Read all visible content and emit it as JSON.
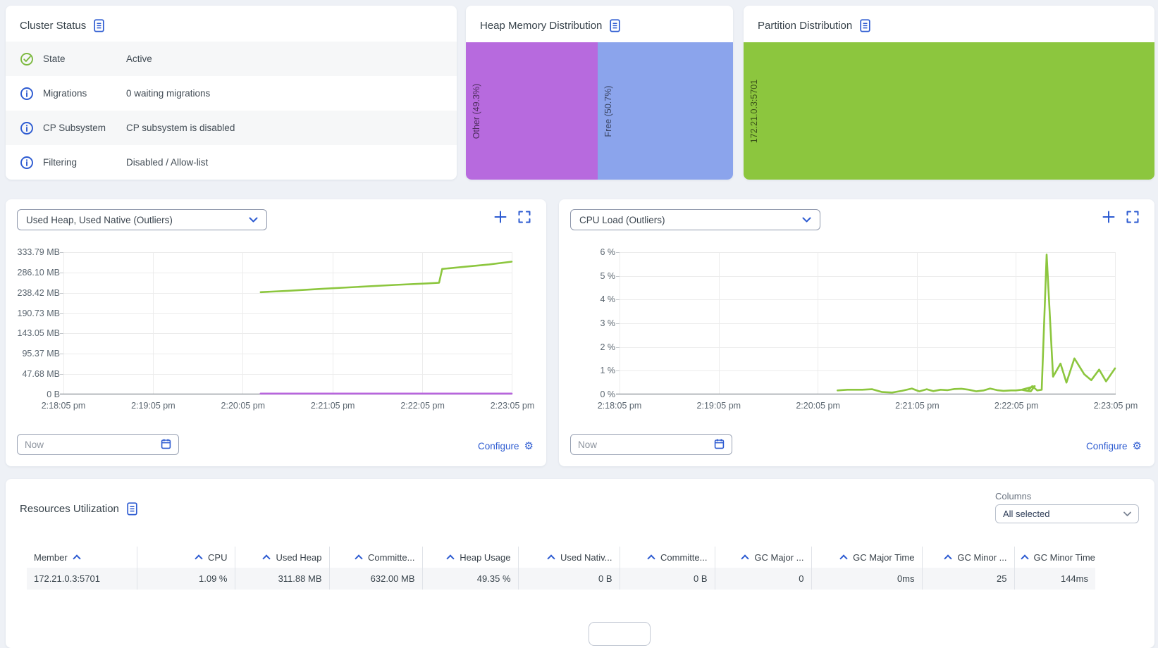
{
  "palette": {
    "accent_blue": "#2d5bd1",
    "chart_green": "#8cc63e",
    "chart_purple": "#b865dd",
    "heap_other_purple": "#b76ade",
    "heap_free_blue": "#8ba4ec",
    "partition_green": "#8cc63e",
    "status_check_green": "#7cb940"
  },
  "cluster_status": {
    "title": "Cluster Status",
    "title_icon": "document-icon",
    "rows": [
      {
        "icon": "check-circle-icon",
        "label": "State",
        "value": "Active"
      },
      {
        "icon": "info-circle-icon",
        "label": "Migrations",
        "value": "0 waiting migrations"
      },
      {
        "icon": "info-circle-icon",
        "label": "CP Subsystem",
        "value": "CP subsystem is disabled"
      },
      {
        "icon": "info-circle-icon",
        "label": "Filtering",
        "value": "Disabled / Allow-list"
      }
    ]
  },
  "heap_memory_distribution": {
    "title": "Heap Memory Distribution",
    "title_icon": "document-icon",
    "segments": [
      {
        "label": "Other (49.3%)",
        "percent": 49.3,
        "color": "#b76ade"
      },
      {
        "label": "Free (50.7%)",
        "percent": 50.7,
        "color": "#8ba4ec"
      }
    ]
  },
  "partition_distribution": {
    "title": "Partition Distribution",
    "title_icon": "document-icon",
    "segments": [
      {
        "label": "172.21.0.3:5701",
        "percent": 100,
        "color": "#8cc63e"
      }
    ]
  },
  "metric_cards": [
    {
      "selector": "Used Heap, Used Native (Outliers)",
      "time_filter": "Now",
      "configure": "Configure",
      "icons": [
        "chevron-down-icon",
        "add-chart-icon",
        "fullscreen-icon",
        "calendar-icon",
        "gear-icon"
      ]
    },
    {
      "selector": "CPU Load (Outliers)",
      "time_filter": "Now",
      "configure": "Configure",
      "icons": [
        "chevron-down-icon",
        "add-chart-icon",
        "fullscreen-icon",
        "calendar-icon",
        "gear-icon"
      ]
    }
  ],
  "chart_data": [
    {
      "type": "line",
      "title": "Used Heap, Used Native (Outliers)",
      "x_ticks": [
        "2:18:05 pm",
        "2:19:05 pm",
        "2:20:05 pm",
        "2:21:05 pm",
        "2:22:05 pm",
        "2:23:05 pm"
      ],
      "y_ticks": [
        "333.79 MB",
        "286.10 MB",
        "238.42 MB",
        "190.73 MB",
        "143.05 MB",
        "95.37 MB",
        "47.68 MB",
        "0 B"
      ],
      "y_max": 333.79,
      "y_unit": "MB",
      "x_note": "point x = fraction of time axis from 2:18:05 pm to 2:23:05 pm",
      "grid": true,
      "legend": "none",
      "series": [
        {
          "name": "Used Heap",
          "color": "#8cc63e",
          "points": [
            [
              0.44,
              240
            ],
            [
              0.5,
              243
            ],
            [
              0.58,
              248
            ],
            [
              0.66,
              252.5
            ],
            [
              0.74,
              257
            ],
            [
              0.81,
              260.5
            ],
            [
              0.838,
              262
            ],
            [
              0.845,
              294.5
            ],
            [
              0.86,
              296
            ],
            [
              0.9,
              300
            ],
            [
              0.95,
              305
            ],
            [
              1,
              311.5
            ]
          ]
        },
        {
          "name": "Used Native",
          "color": "#b865dd",
          "points": [
            [
              0.44,
              2
            ],
            [
              0.62,
              2
            ],
            [
              0.8,
              2
            ],
            [
              1,
              2
            ]
          ]
        }
      ]
    },
    {
      "type": "line",
      "title": "CPU Load (Outliers)",
      "x_ticks": [
        "2:18:05 pm",
        "2:19:05 pm",
        "2:20:05 pm",
        "2:21:05 pm",
        "2:22:05 pm",
        "2:23:05 pm"
      ],
      "y_ticks": [
        "6 %",
        "5 %",
        "4 %",
        "3 %",
        "2 %",
        "1 %",
        "0 %"
      ],
      "y_max": 6,
      "y_unit": "%",
      "x_note": "point x = fraction of time axis from 2:18:05 pm to 2:23:05 pm",
      "grid": true,
      "legend": "none",
      "series": [
        {
          "name": "CPU Load",
          "color": "#8cc63e",
          "points": [
            [
              0.44,
              0.17
            ],
            [
              0.46,
              0.2
            ],
            [
              0.49,
              0.2
            ],
            [
              0.51,
              0.22
            ],
            [
              0.53,
              0.1
            ],
            [
              0.55,
              0.08
            ],
            [
              0.57,
              0.15
            ],
            [
              0.59,
              0.25
            ],
            [
              0.605,
              0.13
            ],
            [
              0.62,
              0.22
            ],
            [
              0.633,
              0.14
            ],
            [
              0.648,
              0.2
            ],
            [
              0.662,
              0.18
            ],
            [
              0.676,
              0.23
            ],
            [
              0.69,
              0.24
            ],
            [
              0.705,
              0.2
            ],
            [
              0.72,
              0.13
            ],
            [
              0.735,
              0.17
            ],
            [
              0.748,
              0.25
            ],
            [
              0.762,
              0.18
            ],
            [
              0.775,
              0.15
            ],
            [
              0.79,
              0.17
            ],
            [
              0.8,
              0.17
            ],
            [
              0.812,
              0.2
            ],
            [
              0.822,
              0.15
            ],
            [
              0.83,
              0.13
            ],
            [
              0.838,
              0.35
            ],
            [
              0.812,
              0.2
            ],
            [
              0.824,
              0.15
            ],
            [
              0.833,
              0.35
            ],
            [
              0.843,
              0.17
            ],
            [
              0.852,
              0.2
            ],
            [
              0.862,
              5.9
            ],
            [
              0.875,
              0.75
            ],
            [
              0.89,
              1.3
            ],
            [
              0.902,
              0.5
            ],
            [
              0.918,
              1.52
            ],
            [
              0.938,
              0.85
            ],
            [
              0.952,
              0.6
            ],
            [
              0.968,
              1.05
            ],
            [
              0.982,
              0.55
            ],
            [
              1,
              1.1
            ]
          ]
        }
      ]
    }
  ],
  "resources": {
    "title": "Resources Utilization",
    "title_icon": "document-icon",
    "columns_label": "Columns",
    "columns_value": "All selected",
    "headers": [
      "Member",
      "CPU",
      "Used Heap",
      "Committe...",
      "Heap Usage",
      "Used Nativ...",
      "Committe...",
      "GC Major ...",
      "GC Major Time",
      "GC Minor ...",
      "GC Minor Time"
    ],
    "rows": [
      [
        "172.21.0.3:5701",
        "1.09 %",
        "311.88 MB",
        "632.00 MB",
        "49.35 %",
        "0 B",
        "0 B",
        "0",
        "0ms",
        "25",
        "144ms"
      ]
    ]
  }
}
